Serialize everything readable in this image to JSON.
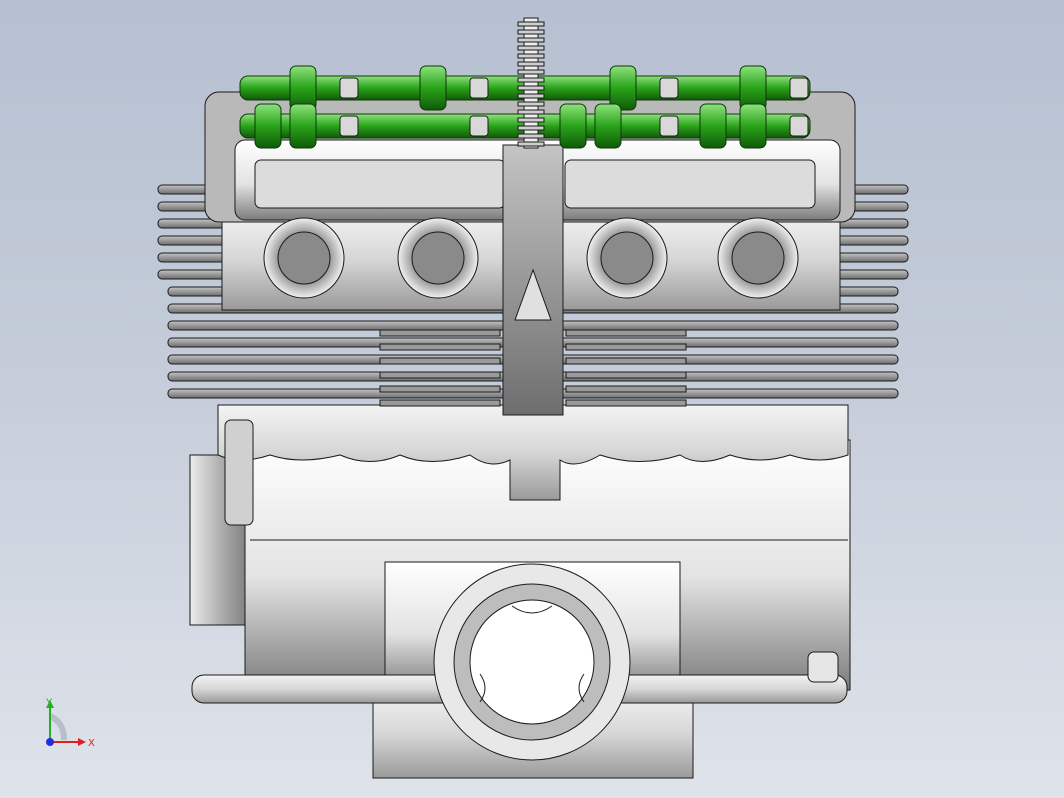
{
  "viewport": {
    "background_top": "#b6c0d1",
    "background_bottom": "#dfe3ea"
  },
  "model": {
    "description_icon": "engine-assembly-icon",
    "camshaft_color": "#2aa31a",
    "body_color": "#d9d9d9",
    "edge_color": "#1a1a1a"
  },
  "triad": {
    "x_label": "X",
    "y_label": "Y",
    "x_color": "#e02020",
    "y_color": "#20b020",
    "z_color": "#2030e0"
  }
}
